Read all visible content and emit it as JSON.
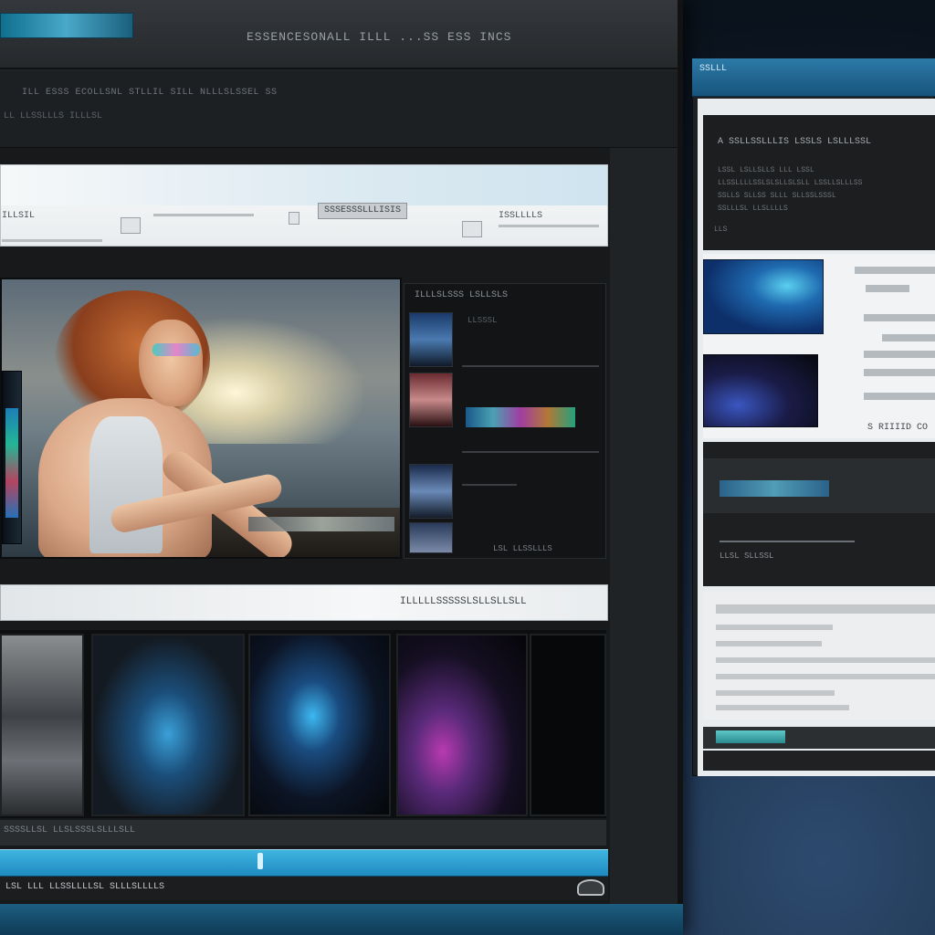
{
  "main_window": {
    "title": "ESSENCESONALL ILLL ...SS ESS  INCS",
    "subheader_line1": "ILL ESSS ECOLLSNL STLLIL SILL NLLLSLSSEL SS",
    "subheader_line2": "LL LLSSLLLS ILLLSL",
    "toolbar": {
      "label_left": "ILLSIL",
      "button_main": "SSSESSSLLLISIS",
      "label_right": "ISSLLLLS"
    },
    "side_panel": {
      "title": "ILLLSLSSS LSLLSLS",
      "subtitle": "LLSSSL",
      "footer": "LSL LLSSLLLS"
    },
    "caption_bar": "ILLLLLSSSSSLSLLSLLSLL",
    "below_thumbs": "SSSSLLSL LLSLSSSLSLLLSLL",
    "status_text": "LSL  LLL  LLSSLLLLSL  SLLLSLLLLS"
  },
  "second_window": {
    "title": "SSLLL",
    "dark_panel": {
      "title": "A SSLLSSLLLIS LSSLS LSLLLSSL",
      "lines": [
        "LSSL LSLLSLLS  LLL  LSSL",
        "LLSSLLLLSSLSLSLLSLSLL  LSSLLSLLLSS",
        "SSLLS SLLSS SLLL  SLLSSLSSSL",
        "SSLLLSL LLSLLLLS"
      ],
      "footer": "LLS"
    },
    "gallery_caption": "S RIIIID CO",
    "list_footer": "LLSL SLLSSL"
  }
}
